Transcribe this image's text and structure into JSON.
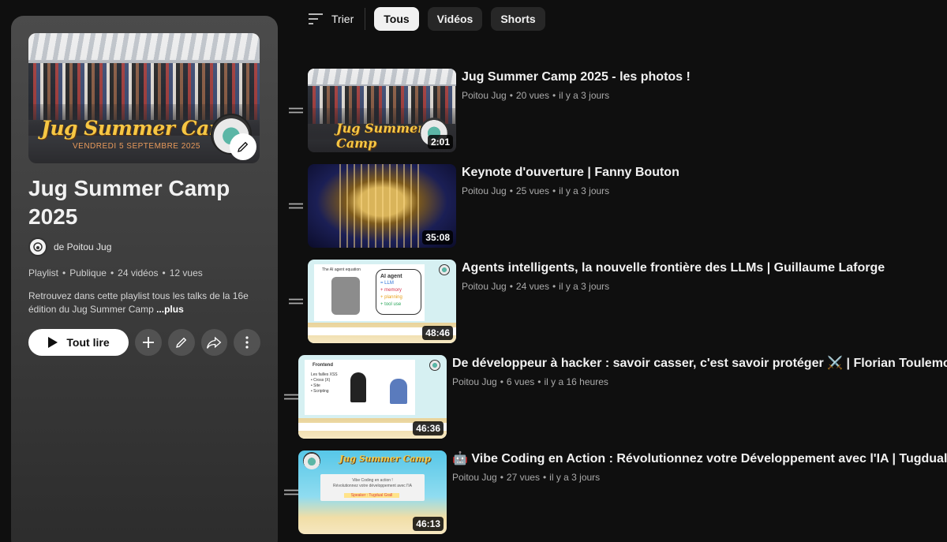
{
  "filters": {
    "sort_label": "Trier",
    "chips": [
      {
        "label": "Tous",
        "active": true
      },
      {
        "label": "Vidéos",
        "active": false
      },
      {
        "label": "Shorts",
        "active": false
      }
    ]
  },
  "playlist": {
    "hero_title": "Jug Summer Camp",
    "hero_subtitle": "VENDREDI 5 SEPTEMBRE 2025",
    "title": "Jug Summer Camp 2025",
    "owner": "de Poitou Jug",
    "meta": [
      "Playlist",
      "•",
      "Publique",
      "•",
      "24 vidéos",
      "•",
      "12 vues"
    ],
    "description": "Retrouvez dans cette playlist tous les talks de la 16e édition du Jug Summer Camp",
    "more_label": "...plus",
    "play_all_label": "Tout lire"
  },
  "videos": [
    {
      "title": "Jug Summer Camp 2025 - les photos !",
      "channel": "Poitou Jug",
      "views": "20 vues",
      "age": "il y a 3 jours",
      "duration": "2:01"
    },
    {
      "title": "Keynote d'ouverture | Fanny Bouton",
      "channel": "Poitou Jug",
      "views": "25 vues",
      "age": "il y a 3 jours",
      "duration": "35:08"
    },
    {
      "title": "Agents intelligents, la nouvelle frontière des LLMs | Guillaume Laforge",
      "channel": "Poitou Jug",
      "views": "24 vues",
      "age": "il y a 3 jours",
      "duration": "48:46"
    },
    {
      "title": "De développeur à hacker : savoir casser, c'est savoir protéger ⚔️ | Florian Toulemont",
      "channel": "Poitou Jug",
      "views": "6 vues",
      "age": "il y a 16 heures",
      "duration": "46:36"
    },
    {
      "title": "🤖 Vibe Coding en Action : Révolutionnez votre Développement avec l'IA | Tugdual Grall",
      "channel": "Poitou Jug",
      "views": "27 vues",
      "age": "il y a 3 jours",
      "duration": "46:13"
    }
  ],
  "thumb_text": {
    "t1_title": "Jug Summer Camp",
    "t3_slide_title": "The AI agent equation",
    "t3_bubble": [
      "AI agent",
      "= LLM",
      "+ memory",
      "+ planning",
      "+ tool use"
    ],
    "t4_slide_title": "Frontend",
    "t4_list": [
      "Les failles XSS",
      "• Cross (X)",
      "• Site",
      "• Scripting"
    ],
    "t5_title": "Jug Summer Camp",
    "t5_card": [
      "Vibe Coding en action !",
      "Révolutionnez votre développement avec l'IA"
    ],
    "t5_speaker": "Speaker : Tugdual Grall"
  }
}
